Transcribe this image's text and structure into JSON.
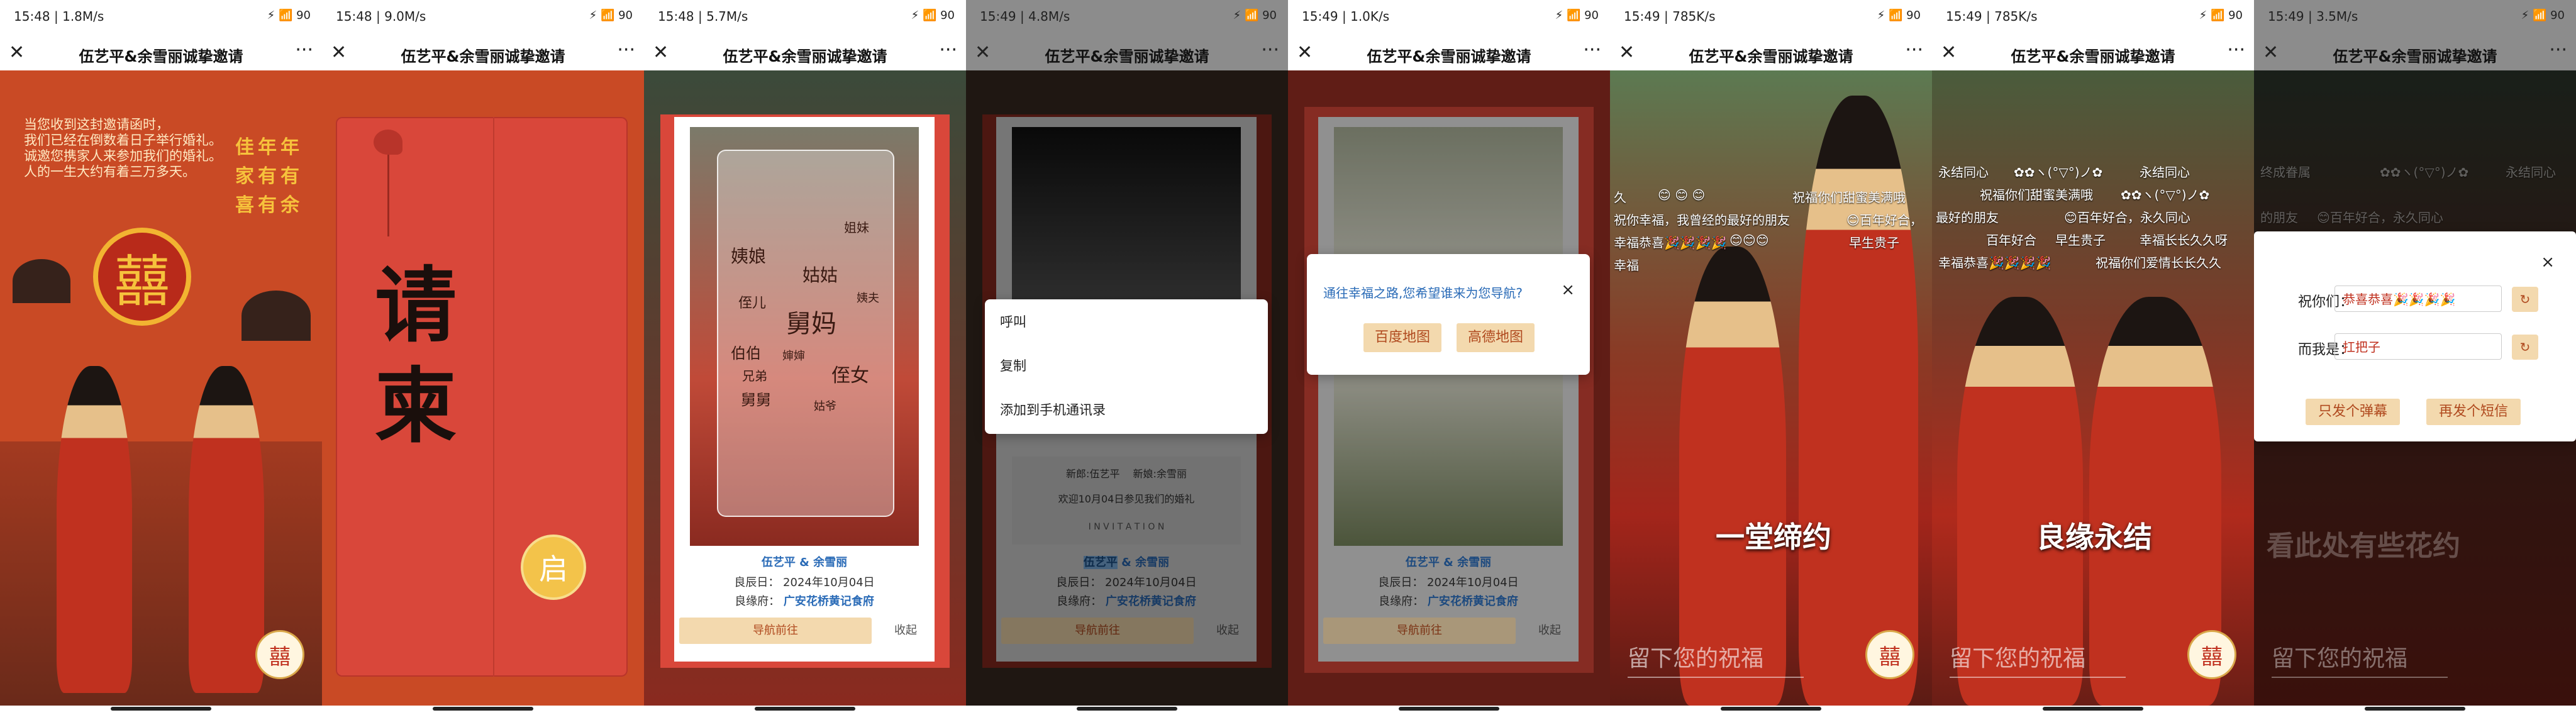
{
  "app": {
    "title": "伍艺平&余雪丽诚挚邀请",
    "more_label": "···",
    "close_label": "✕"
  },
  "status": [
    {
      "time": "15:48 | 1.8M/s",
      "icons": "⚡ 📶 90"
    },
    {
      "time": "15:48 | 9.0M/s",
      "icons": "⚡ 📶 90"
    },
    {
      "time": "15:48 | 5.7M/s",
      "icons": "⚡ 📶 90"
    },
    {
      "time": "15:49 | 4.8M/s",
      "icons": "⚡ 📶 90"
    },
    {
      "time": "15:49 | 1.0K/s",
      "icons": "⚡ 📶 90"
    },
    {
      "time": "15:49 | 785K/s",
      "icons": "⚡ 📶 90"
    },
    {
      "time": "15:49 | 785K/s",
      "icons": "⚡ 📶 90"
    },
    {
      "time": "15:49 | 3.5M/s",
      "icons": "⚡ 📶 90"
    }
  ],
  "p1": {
    "intro": [
      "当您收到这封邀请函时，",
      "我们已经在倒数着日子举行婚礼。",
      "诚邀您携家人来参加我们的婚礼。",
      "人的一生大约有着三万多天。"
    ],
    "vertical": [
      [
        "佳",
        "家",
        "喜"
      ],
      [
        "年",
        "有",
        "有"
      ],
      [
        "年",
        "有",
        "余"
      ]
    ],
    "xi": "囍",
    "avatar": "囍"
  },
  "p2": {
    "title": [
      "请",
      "柬"
    ],
    "seal": "启"
  },
  "p3": {
    "relatives": [
      "姨娘",
      "姐妹",
      "姑姑",
      "侄儿",
      "舅妈",
      "姨夫",
      "伯伯",
      "婶婶",
      "兄弟",
      "侄女",
      "舅舅",
      "姑爷"
    ],
    "names": "伍艺平 & 余雪丽",
    "date": "良辰日：  2024年10月04日",
    "place_label": "良缘府：",
    "place": "广安花桥黄记食府",
    "nav_btn": "导航前往",
    "collapse_btn": "收起"
  },
  "p4": {
    "menu": [
      "呼叫",
      "复制",
      "添加到手机通讯录"
    ],
    "groom": "新郎:伍艺平",
    "bride": "新娘:余雪丽",
    "invite_line": "欢迎10月04日参见我们的婚礼",
    "invitation": "I N V I T A T I O N",
    "names_selected": "伍艺平",
    "names_rest": " & 余雪丽",
    "date": "良辰日：  2024年10月04日",
    "place_label": "良缘府：",
    "place": "广安花桥黄记食府",
    "nav_btn": "导航前往",
    "collapse_btn": "收起"
  },
  "p5": {
    "question": "通往幸福之路,您希望谁来为您导航?",
    "baidu": "百度地图",
    "gaode": "高德地图",
    "close": "×",
    "names": "伍艺平 & 余雪丽",
    "date": "良辰日：  2024年10月04日",
    "place_label": "良缘府：",
    "place": "广安花桥黄记食府",
    "nav_btn": "导航前往",
    "collapse_btn": "收起"
  },
  "p6": {
    "danmu": [
      "久",
      "😊 😊 😊",
      "祝福你们甜蜜美满哦",
      "祝你幸福，我曾经的最好的朋友",
      "😊百年好合，",
      "幸福恭喜🎉🎉🎉🎉",
      "😊😊😊",
      "早生贵子",
      "幸福"
    ],
    "big": "一堂缔约",
    "bottom": "留下您的祝福",
    "avatar": "囍"
  },
  "p7": {
    "danmu": [
      "永结同心",
      "✿✿ヽ(°▽°)ノ✿",
      "永结同心",
      "祝福你们甜蜜美满哦",
      "✿✿ヽ(°▽°)ノ✿",
      "最好的朋友",
      "😊百年好合，永久同心",
      "百年好合",
      "早生贵子",
      "幸福长长久久呀",
      "幸福恭喜🎉🎉🎉🎉",
      "祝福你们爱情长长久久"
    ],
    "big": "良缘永结",
    "bottom": "留下您的祝福",
    "avatar": "囍"
  },
  "p8": {
    "wish_label": "祝你们：",
    "wish_value": "恭喜恭喜🎉🎉🎉🎉",
    "me_label": "而我是：",
    "me_value": "扛把子",
    "send_danmu": "只发个弹幕",
    "send_sms": "再发个短信",
    "close": "×",
    "bg_text": "看此处有些花约",
    "bottom": "留下您的祝福",
    "danmu": [
      "终成眷属",
      "✿✿ヽ(°▽°)ノ✿",
      "永结同心",
      "的朋友",
      "😊百年好合，永久同心"
    ]
  },
  "colors": {
    "accent": "#c0311f",
    "gold": "#f3d9ae",
    "card_blue": "#2a6bb7"
  }
}
